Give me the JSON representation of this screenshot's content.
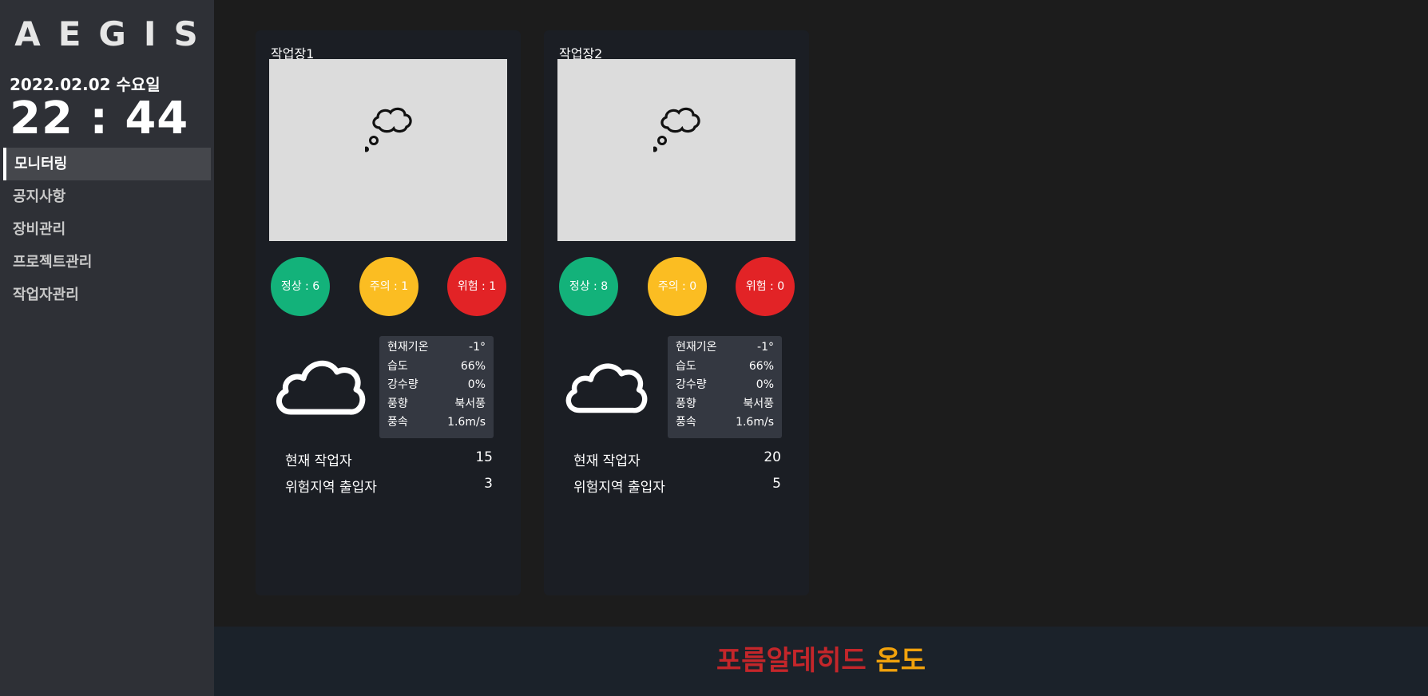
{
  "app": {
    "logo": "AEGIS"
  },
  "datetime": {
    "date": "2022.02.02",
    "weekday": "수요일",
    "hour": "22",
    "separator": ":",
    "minute": "44"
  },
  "sidebar": {
    "items": [
      {
        "label": "모니터링",
        "active": true
      },
      {
        "label": "공지사항",
        "active": false
      },
      {
        "label": "장비관리",
        "active": false
      },
      {
        "label": "프로젝트관리",
        "active": false
      },
      {
        "label": "작업자관리",
        "active": false
      }
    ]
  },
  "sites": [
    {
      "title": "작업장1",
      "status": {
        "normal": "정상 : 6",
        "caution": "주의 : 1",
        "danger": "위험 : 1"
      },
      "weather": [
        {
          "label": "현재기온",
          "value": "-1°"
        },
        {
          "label": "습도",
          "value": "66%"
        },
        {
          "label": "강수량",
          "value": "0%"
        },
        {
          "label": "풍향",
          "value": "북서풍"
        },
        {
          "label": "풍속",
          "value": "1.6m/s"
        }
      ],
      "stats": [
        {
          "label": "현재 작업자",
          "value": "15"
        },
        {
          "label": "위험지역 출입자",
          "value": "3"
        }
      ]
    },
    {
      "title": "작업장2",
      "status": {
        "normal": "정상 : 8",
        "caution": "주의 : 0",
        "danger": "위험 : 0"
      },
      "weather": [
        {
          "label": "현재기온",
          "value": "-1°"
        },
        {
          "label": "습도",
          "value": "66%"
        },
        {
          "label": "강수량",
          "value": "0%"
        },
        {
          "label": "풍향",
          "value": "북서풍"
        },
        {
          "label": "풍속",
          "value": "1.6m/s"
        }
      ],
      "stats": [
        {
          "label": "현재 작업자",
          "value": "20"
        },
        {
          "label": "위험지역 출입자",
          "value": "5"
        }
      ]
    }
  ],
  "footer": {
    "part1": "포름알데히드",
    "part2": "온도"
  },
  "colors": {
    "normal": "#13b27a",
    "caution": "#fbbd22",
    "danger": "#e22326",
    "footer_red": "#c4262a",
    "footer_orange": "#f1a20c"
  },
  "icons": {
    "camera_placeholder": "thought-bubble-icon",
    "weather": "cloud-icon"
  }
}
